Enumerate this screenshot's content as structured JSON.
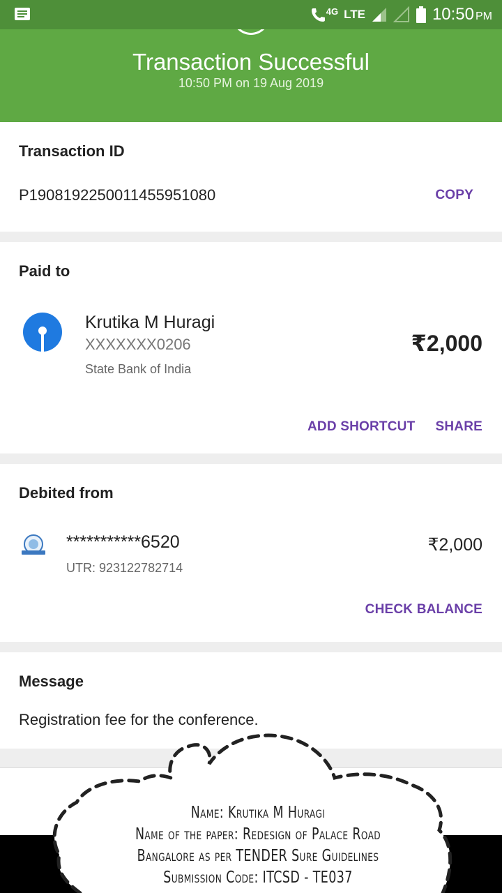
{
  "status_bar": {
    "network": "4G",
    "lte": "LTE",
    "time": "10:50",
    "ampm": "PM",
    "icons": [
      "message-icon",
      "wifi-calling-icon",
      "signal-icon",
      "signal-empty-icon",
      "battery-icon"
    ]
  },
  "header": {
    "title": "Transaction Successful",
    "subtitle": "10:50 PM on 19 Aug 2019",
    "color": "#5fa944"
  },
  "transaction": {
    "label": "Transaction ID",
    "id": "P1908192250011455951080",
    "copy_label": "COPY"
  },
  "paid_to": {
    "label": "Paid to",
    "name": "Krutika M Huragi",
    "account": "XXXXXXX0206",
    "bank": "State Bank of India",
    "amount": "₹2,000",
    "add_shortcut_label": "ADD SHORTCUT",
    "share_label": "SHARE"
  },
  "debited_from": {
    "label": "Debited from",
    "account": "***********6520",
    "utr": "UTR: 923122782714",
    "amount": "₹2,000",
    "check_balance_label": "CHECK BALANCE"
  },
  "message": {
    "label": "Message",
    "text": "Registration fee for the conference."
  },
  "annotation": {
    "line1": "Name: Krutika M Huragi",
    "line2": "Name of the paper: Redesign of Palace Road",
    "line3": "Bangalore as per TENDER Sure Guidelines",
    "line4": "Submission Code: ITCSD - TE037"
  },
  "accent_color": "#6a3fa8"
}
